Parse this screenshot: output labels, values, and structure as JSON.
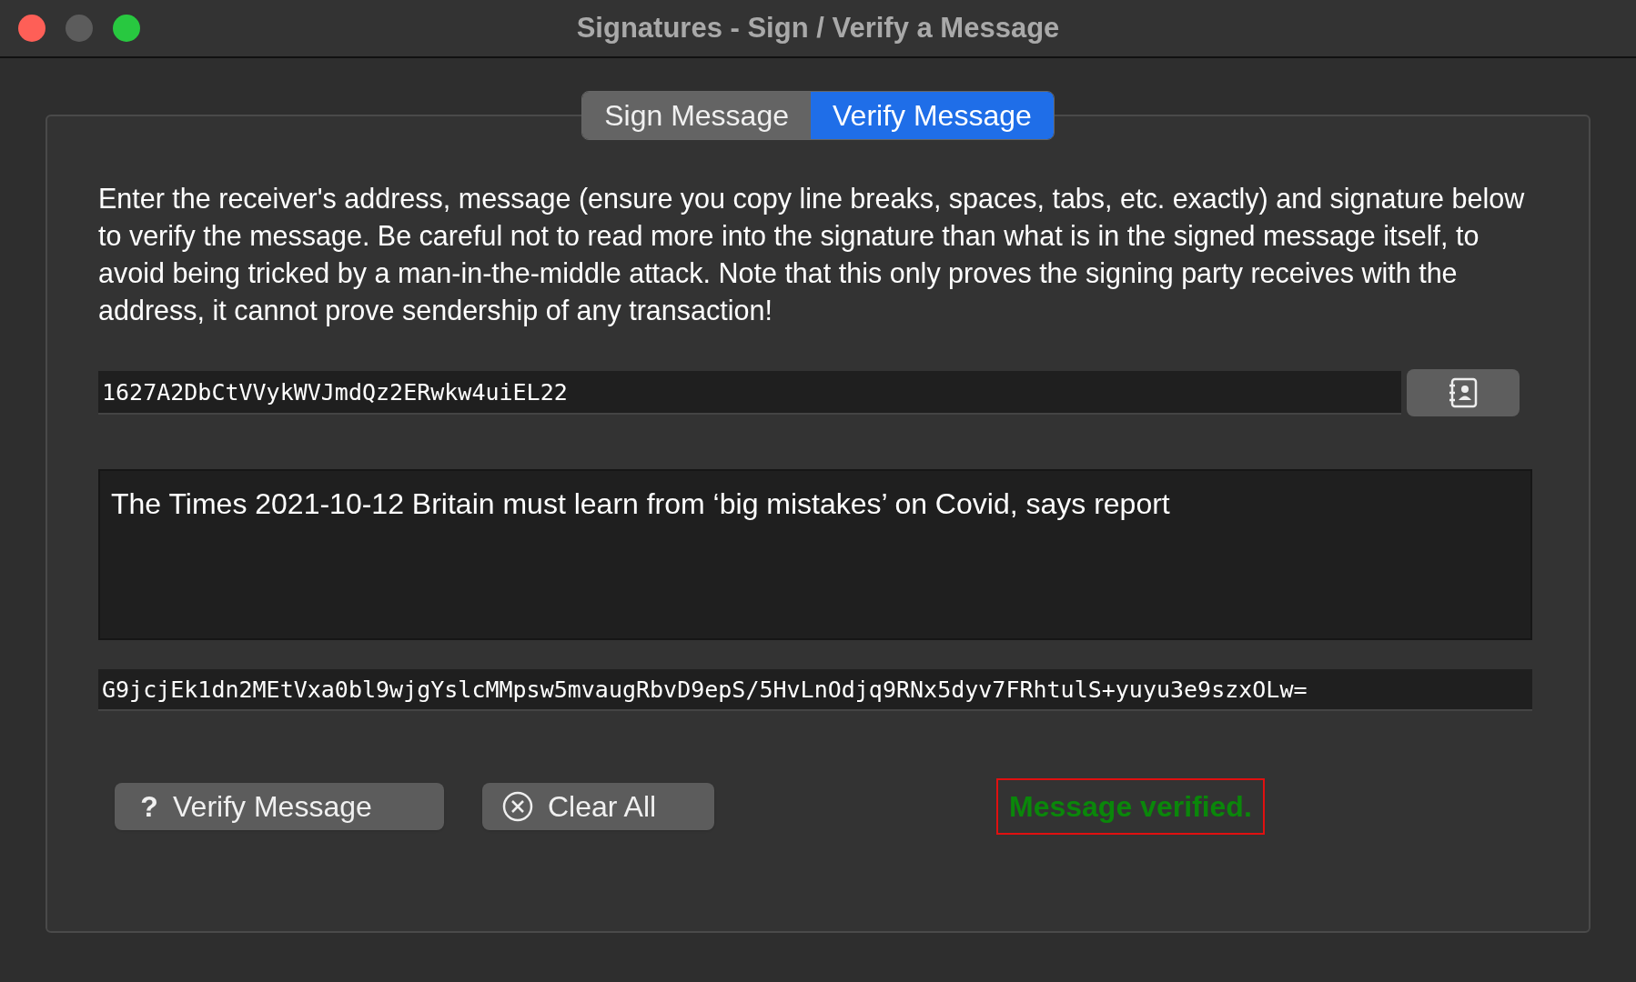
{
  "window": {
    "title": "Signatures - Sign / Verify a Message"
  },
  "tabs": [
    {
      "label": "Sign Message",
      "selected": false
    },
    {
      "label": "Verify Message",
      "selected": true
    }
  ],
  "instructions": "Enter the receiver's address, message (ensure you copy line breaks, spaces, tabs, etc. exactly) and signature below to verify the message. Be careful not to read more into the signature than what is in the signed message itself, to avoid being tricked by a man-in-the-middle attack. Note that this only proves the signing party receives with the address, it cannot prove sendership of any transaction!",
  "address": {
    "value": "1627A2DbCtVVykWVJmdQz2ERwkw4uiEL22"
  },
  "message": {
    "value": "The Times 2021-10-12 Britain must learn from ‘big mistakes’ on Covid, says report"
  },
  "signature": {
    "value": "G9jcjEk1dn2MEtVxa0bl9wjgYslcMMpsw5mvaugRbvD9epS/5HvLnOdjq9RNx5dyv7FRhtulS+yuyu3e9szxOLw="
  },
  "buttons": [
    {
      "label": "Verify Message",
      "kind": "verify",
      "icon": "?"
    },
    {
      "label": "Clear All",
      "kind": "clear"
    }
  ],
  "status": {
    "text": "Message verified.",
    "kind": "success"
  }
}
